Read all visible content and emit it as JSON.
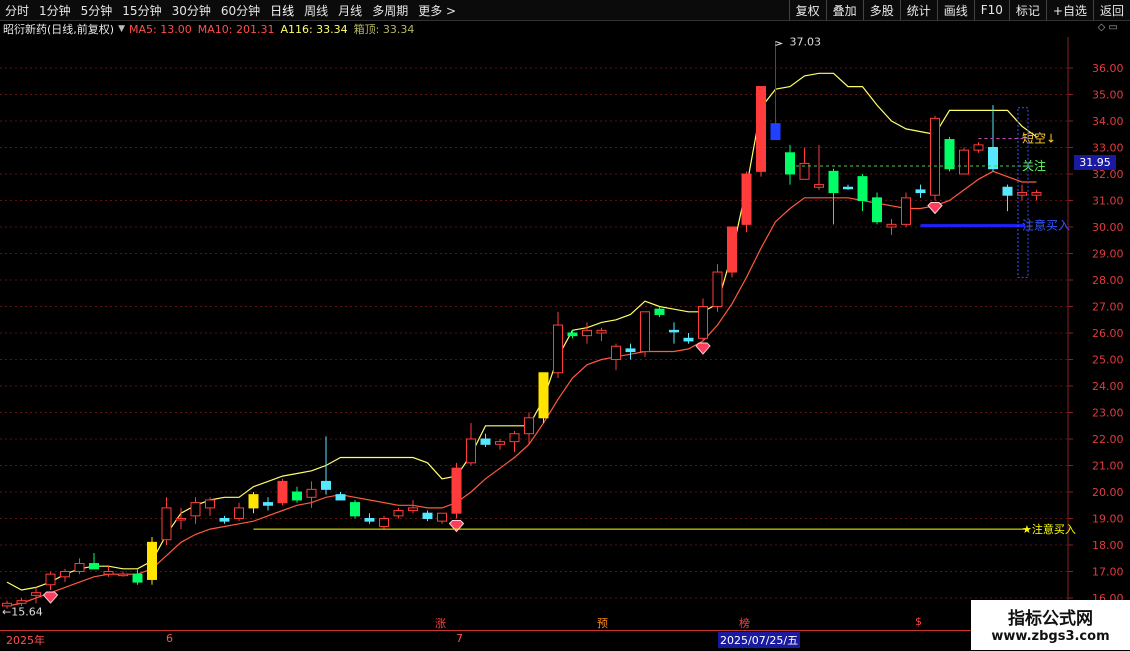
{
  "toolbar": {
    "periods": [
      "分时",
      "1分钟",
      "5分钟",
      "15分钟",
      "30分钟",
      "60分钟",
      "日线",
      "周线",
      "月线",
      "多周期",
      "更多 >"
    ],
    "tools": [
      "复权",
      "叠加",
      "多股",
      "统计",
      "画线",
      "F10",
      "标记",
      "+自选",
      "返回"
    ]
  },
  "info": {
    "stock": "昭衍新药(日线,前复权)",
    "ma5": "MA5: 13.00",
    "ma10": "MA10: 201.31",
    "a116": "A116: 33.34",
    "box": "箱顶: 33.34",
    "icons": "◇ ▭"
  },
  "price_tag": "31.95",
  "time_axis": {
    "year": "2025年",
    "m6": "6",
    "m7": "7",
    "date": "2025/07/25/五"
  },
  "markers": {
    "zhang": "涨",
    "yu": "预",
    "bang": "榜",
    "dollar": "$"
  },
  "watermark": {
    "line1": "指标公式网",
    "line2": "www.zbgs3.com"
  },
  "chart_data": {
    "type": "candlestick",
    "y_ticks": [
      16,
      17,
      18,
      19,
      20,
      21,
      22,
      23,
      24,
      25,
      26,
      27,
      28,
      29,
      30,
      31,
      32,
      33,
      34,
      35,
      36
    ],
    "y_labels": [
      "16.00",
      "17.00",
      "18.00",
      "19.00",
      "20.00",
      "21.00",
      "22.00",
      "23.00",
      "24.00",
      "25.00",
      "26.00",
      "27.00",
      "28.00",
      "29.00",
      "30.00",
      "31.00",
      "32.00",
      "33.00",
      "34.00",
      "35.00",
      "36.00"
    ],
    "high_label": "37.03",
    "low_label": "15.64",
    "annotations": {
      "short": "短空↓",
      "watch": "关注",
      "buy1": "注意买入",
      "buy2": "★注意买入"
    },
    "colors": {
      "up": "#ff3c3c",
      "down": "#00ff66",
      "ma": "#ff5a3c",
      "box": "#ffff66",
      "buy_line": "#ffff00",
      "bright_yellow": "#ffe400",
      "cyan": "#55e8ff",
      "blue": "#2040ff",
      "buy_blue": "#2020ff"
    },
    "candles": [
      [
        15.7,
        15.9,
        15.6,
        15.8,
        "h"
      ],
      [
        15.8,
        16.0,
        15.7,
        15.9,
        "h"
      ],
      [
        16.1,
        16.4,
        15.8,
        16.2,
        "h"
      ],
      [
        16.5,
        17.0,
        16.3,
        16.9,
        "h"
      ],
      [
        16.8,
        17.1,
        16.6,
        17.0,
        "h"
      ],
      [
        17.0,
        17.5,
        16.9,
        17.3,
        "h"
      ],
      [
        17.3,
        17.7,
        17.1,
        17.1,
        "d"
      ],
      [
        16.9,
        17.2,
        16.8,
        17.0,
        "h"
      ],
      [
        16.9,
        17.0,
        16.8,
        16.9,
        "h"
      ],
      [
        16.9,
        17.1,
        16.5,
        16.6,
        "d"
      ],
      [
        16.7,
        18.3,
        16.5,
        18.1,
        "y"
      ],
      [
        18.2,
        19.8,
        18.0,
        19.4,
        "h"
      ],
      [
        19.0,
        19.4,
        18.6,
        19.0,
        "h"
      ],
      [
        19.1,
        19.8,
        18.8,
        19.6,
        "h"
      ],
      [
        19.4,
        19.8,
        19.1,
        19.7,
        "h"
      ],
      [
        19.0,
        19.1,
        18.8,
        18.9,
        "c"
      ],
      [
        19.0,
        19.6,
        18.9,
        19.4,
        "h"
      ],
      [
        19.4,
        20.0,
        19.2,
        19.9,
        "y"
      ],
      [
        19.6,
        19.8,
        19.3,
        19.5,
        "c"
      ],
      [
        19.6,
        20.5,
        19.5,
        20.4,
        "r"
      ],
      [
        20.0,
        20.2,
        19.6,
        19.7,
        "d"
      ],
      [
        19.8,
        20.4,
        19.4,
        20.1,
        "h"
      ],
      [
        20.1,
        22.1,
        19.9,
        20.4,
        "c"
      ],
      [
        19.9,
        20.0,
        19.7,
        19.7,
        "c"
      ],
      [
        19.6,
        19.7,
        19.0,
        19.1,
        "d"
      ],
      [
        19.0,
        19.2,
        18.8,
        18.9,
        "c"
      ],
      [
        18.7,
        19.1,
        18.6,
        19.0,
        "h"
      ],
      [
        19.1,
        19.4,
        19.0,
        19.3,
        "h"
      ],
      [
        19.3,
        19.7,
        19.2,
        19.4,
        "h"
      ],
      [
        19.2,
        19.3,
        18.9,
        19.0,
        "c"
      ],
      [
        18.9,
        19.2,
        18.8,
        19.2,
        "h"
      ],
      [
        19.2,
        21.1,
        19.0,
        20.9,
        "r"
      ],
      [
        21.1,
        22.6,
        21.0,
        22.0,
        "h"
      ],
      [
        22.0,
        22.2,
        21.7,
        21.8,
        "c"
      ],
      [
        21.8,
        22.0,
        21.6,
        21.9,
        "h"
      ],
      [
        21.9,
        22.3,
        21.5,
        22.2,
        "h"
      ],
      [
        22.2,
        23.0,
        21.8,
        22.8,
        "h"
      ],
      [
        22.8,
        24.5,
        22.6,
        24.5,
        "y"
      ],
      [
        24.5,
        26.8,
        24.3,
        26.3,
        "h"
      ],
      [
        26.0,
        26.1,
        25.8,
        25.9,
        "d"
      ],
      [
        25.9,
        26.4,
        25.6,
        26.1,
        "h"
      ],
      [
        26.1,
        26.2,
        25.7,
        26.0,
        "h"
      ],
      [
        25.0,
        25.6,
        24.6,
        25.5,
        "h"
      ],
      [
        25.4,
        25.6,
        25.0,
        25.3,
        "c"
      ],
      [
        25.3,
        26.8,
        25.1,
        26.8,
        "h"
      ],
      [
        26.9,
        27.0,
        26.6,
        26.7,
        "d"
      ],
      [
        26.1,
        26.4,
        25.6,
        26.1,
        "c"
      ],
      [
        25.8,
        26.0,
        25.6,
        25.7,
        "c"
      ],
      [
        25.8,
        27.3,
        25.7,
        27.0,
        "h"
      ],
      [
        27.0,
        28.6,
        26.8,
        28.3,
        "h"
      ],
      [
        28.3,
        30.0,
        28.1,
        30.0,
        "r"
      ],
      [
        30.1,
        32.1,
        29.8,
        32.0,
        "r"
      ],
      [
        32.1,
        35.3,
        31.9,
        35.3,
        "r"
      ],
      [
        33.9,
        37.0,
        33.8,
        33.3,
        "b"
      ],
      [
        32.8,
        33.1,
        31.6,
        32.0,
        "d"
      ],
      [
        32.4,
        33.0,
        31.8,
        31.8,
        "h"
      ],
      [
        31.6,
        33.1,
        31.4,
        31.5,
        "h"
      ],
      [
        32.1,
        32.2,
        30.1,
        31.3,
        "d"
      ],
      [
        31.5,
        31.6,
        31.4,
        31.5,
        "c"
      ],
      [
        31.9,
        32.0,
        30.6,
        31.0,
        "d"
      ],
      [
        31.1,
        31.3,
        30.1,
        30.2,
        "d"
      ],
      [
        30.1,
        30.3,
        29.7,
        30.0,
        "h"
      ],
      [
        30.1,
        31.3,
        30.0,
        31.1,
        "h"
      ],
      [
        31.4,
        31.6,
        31.1,
        31.3,
        "c"
      ],
      [
        31.2,
        34.2,
        31.0,
        34.1,
        "h"
      ],
      [
        33.3,
        33.4,
        32.1,
        32.2,
        "d"
      ],
      [
        32.0,
        33.0,
        32.0,
        32.9,
        "h"
      ],
      [
        32.9,
        33.2,
        32.8,
        33.1,
        "h"
      ],
      [
        33.0,
        34.6,
        32.1,
        32.2,
        "c"
      ],
      [
        31.5,
        31.6,
        30.6,
        31.2,
        "c"
      ],
      [
        31.2,
        31.6,
        31.0,
        31.3,
        "h"
      ],
      [
        31.3,
        31.4,
        31.0,
        31.2,
        "h"
      ]
    ],
    "ma_line": [
      15.7,
      15.8,
      16.0,
      16.2,
      16.4,
      16.6,
      16.8,
      16.9,
      16.9,
      16.9,
      17.1,
      17.6,
      18.1,
      18.4,
      18.6,
      18.7,
      18.8,
      18.9,
      19.1,
      19.3,
      19.5,
      19.6,
      19.8,
      19.9,
      19.8,
      19.7,
      19.6,
      19.5,
      19.5,
      19.4,
      19.4,
      19.6,
      20.0,
      20.5,
      20.9,
      21.3,
      21.8,
      22.6,
      23.5,
      24.3,
      24.8,
      25.0,
      25.1,
      25.2,
      25.3,
      25.3,
      25.3,
      25.4,
      25.7,
      26.3,
      27.1,
      28.1,
      29.2,
      30.2,
      30.7,
      31.1,
      31.1,
      31.1,
      31.1,
      31.0,
      30.9,
      30.8,
      30.7,
      30.7,
      30.8,
      31.0,
      31.4,
      31.8,
      32.1,
      31.9,
      31.7,
      31.7
    ],
    "box_top": [
      16.6,
      16.3,
      16.4,
      16.6,
      16.9,
      17.1,
      17.2,
      17.2,
      17.1,
      17.1,
      17.4,
      18.4,
      19.2,
      19.5,
      19.7,
      19.8,
      19.8,
      20.2,
      20.4,
      20.6,
      20.7,
      20.8,
      21.0,
      21.3,
      21.3,
      21.3,
      21.3,
      21.3,
      21.3,
      21.1,
      20.5,
      20.6,
      21.4,
      22.5,
      22.5,
      22.5,
      22.5,
      23.5,
      25.1,
      26.1,
      26.2,
      26.4,
      26.5,
      26.7,
      27.2,
      27.0,
      26.9,
      26.8,
      26.8,
      27.1,
      29.0,
      31.5,
      34.5,
      35.2,
      35.3,
      35.7,
      35.8,
      35.8,
      35.3,
      35.3,
      34.6,
      34.0,
      33.7,
      33.6,
      33.5,
      34.4,
      34.4,
      34.4,
      34.4,
      34.4,
      33.8,
      33.4
    ],
    "buy_level": 18.6,
    "diamond_idx": [
      3,
      31,
      48,
      64
    ]
  }
}
